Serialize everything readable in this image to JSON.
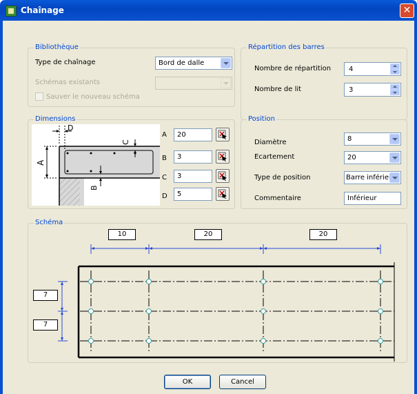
{
  "window": {
    "title": "Chaînage",
    "close_glyph": "✕"
  },
  "bibliotheque": {
    "legend": "Bibliothèque",
    "type_label": "Type de chaînage",
    "type_value": "Bord de dalle",
    "schemas_label": "Schémas existants",
    "schemas_value": "",
    "save_label": "Sauver le nouveau schéma"
  },
  "repartition": {
    "legend": "Répartition des barres",
    "nombre_repartition_label": "Nombre de répartition",
    "nombre_repartition_value": "4",
    "nombre_lit_label": "Nombre de lit",
    "nombre_lit_value": "3"
  },
  "dimensions": {
    "legend": "Dimensions",
    "fields": [
      {
        "letter": "A",
        "value": "20"
      },
      {
        "letter": "B",
        "value": "3"
      },
      {
        "letter": "C",
        "value": "3"
      },
      {
        "letter": "D",
        "value": "5"
      }
    ],
    "diagram_labels": {
      "d": "D",
      "c": "C",
      "a": "A",
      "b": "B"
    }
  },
  "position": {
    "legend": "Position",
    "diametre_label": "Diamètre",
    "diametre_value": "8",
    "ecartement_label": "Ecartement",
    "ecartement_value": "20",
    "type_position_label": "Type de position",
    "type_position_value": "Barre inférieur",
    "commentaire_label": "Commentaire",
    "commentaire_value": "Inférieur"
  },
  "schema": {
    "legend": "Schéma",
    "top_dims": [
      "10",
      "20",
      "20"
    ],
    "left_dims": [
      "7",
      "7"
    ]
  },
  "buttons": {
    "ok": "OK",
    "cancel": "Cancel"
  },
  "colors": {
    "accent": "#0046d5",
    "title_bar": "#0a52d0",
    "dim_line": "#2a4ad8",
    "bar_dot": "#3aa0a0"
  }
}
